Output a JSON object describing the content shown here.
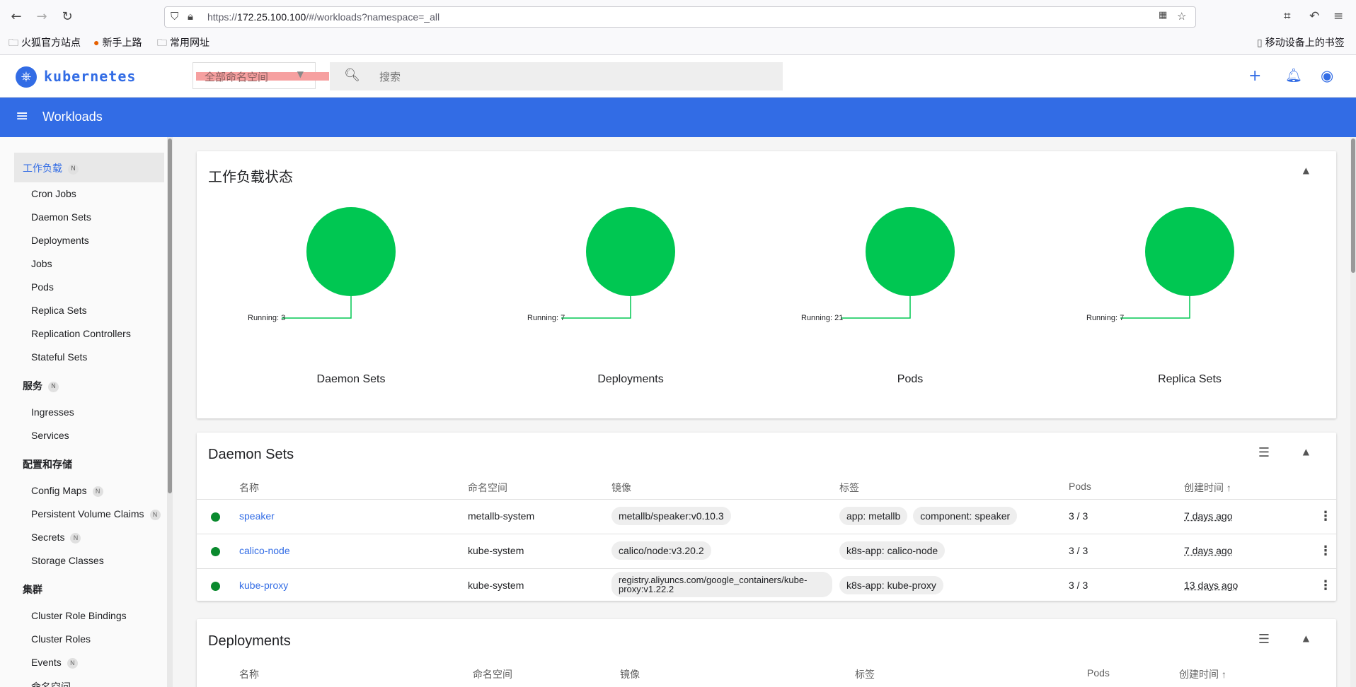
{
  "browser": {
    "url_prefix": "https://",
    "url_host": "172.25.100.100",
    "url_path": "/#/workloads?namespace=_all",
    "bookmarks": [
      "火狐官方站点",
      "新手上路",
      "常用网址"
    ],
    "mobile_bookmarks": "移动设备上的书签"
  },
  "header": {
    "logo_text": "kubernetes",
    "namespace_selected": "全部命名空间",
    "search_placeholder": "搜索"
  },
  "toolbar": {
    "title": "Workloads"
  },
  "sidebar": {
    "sections": [
      {
        "label": "工作负载",
        "badge": "N",
        "items": [
          "Cron Jobs",
          "Daemon Sets",
          "Deployments",
          "Jobs",
          "Pods",
          "Replica Sets",
          "Replication Controllers",
          "Stateful Sets"
        ]
      },
      {
        "label": "服务",
        "badge": "N",
        "items": [
          "Ingresses",
          "Services"
        ]
      },
      {
        "label": "配置和存储",
        "items": [
          "Config Maps",
          "Persistent Volume Claims",
          "Secrets",
          "Storage Classes"
        ],
        "item_badges": {
          "Config Maps": "N",
          "Persistent Volume Claims": "N",
          "Secrets": "N"
        }
      },
      {
        "label": "集群",
        "items": [
          "Cluster Role Bindings",
          "Cluster Roles",
          "Events",
          "命名空间"
        ],
        "item_badges": {
          "Events": "N"
        }
      }
    ]
  },
  "status_card": {
    "title": "工作负载状态",
    "charts": [
      {
        "name": "Daemon Sets",
        "running": "Running: 3"
      },
      {
        "name": "Deployments",
        "running": "Running: 7"
      },
      {
        "name": "Pods",
        "running": "Running: 21"
      },
      {
        "name": "Replica Sets",
        "running": "Running: 7"
      }
    ],
    "color_running": "#00c752"
  },
  "daemonsets_card": {
    "title": "Daemon Sets",
    "headers": [
      "名称",
      "命名空间",
      "镜像",
      "标签",
      "Pods",
      "创建时间"
    ],
    "sort_arrow": "↑",
    "rows": [
      {
        "name": "speaker",
        "namespace": "metallb-system",
        "image": "metallb/speaker:v0.10.3",
        "labels": [
          "app: metallb",
          "component: speaker"
        ],
        "pods": "3 / 3",
        "created": "7 days ago"
      },
      {
        "name": "calico-node",
        "namespace": "kube-system",
        "image": "calico/node:v3.20.2",
        "labels": [
          "k8s-app: calico-node"
        ],
        "pods": "3 / 3",
        "created": "7 days ago"
      },
      {
        "name": "kube-proxy",
        "namespace": "kube-system",
        "image": "registry.aliyuncs.com/google_containers/kube-proxy:v1.22.2",
        "labels": [
          "k8s-app: kube-proxy"
        ],
        "pods": "3 / 3",
        "created": "13 days ago"
      }
    ]
  },
  "deployments_card": {
    "title": "Deployments",
    "headers": [
      "名称",
      "命名空间",
      "镜像",
      "标签",
      "Pods",
      "创建时间"
    ],
    "sort_arrow": "↑"
  }
}
